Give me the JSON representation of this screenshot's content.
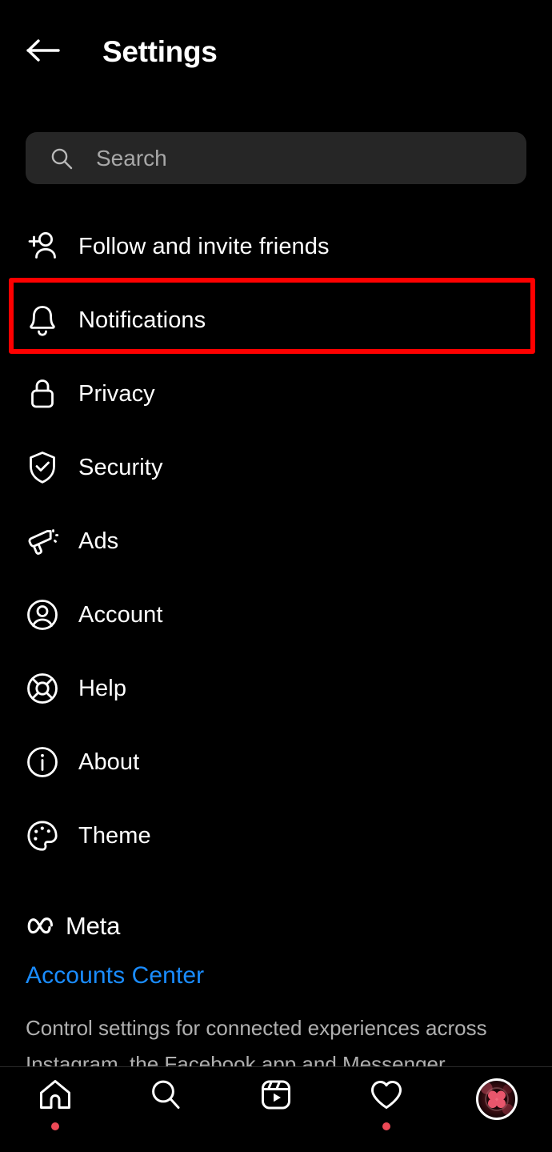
{
  "header": {
    "title": "Settings",
    "back_icon": "arrow-left-icon"
  },
  "search": {
    "placeholder": "Search",
    "value": "",
    "icon": "search-icon"
  },
  "menu": {
    "items": [
      {
        "label": "Follow and invite friends",
        "icon": "person-add-icon",
        "highlighted": false
      },
      {
        "label": "Notifications",
        "icon": "bell-icon",
        "highlighted": true
      },
      {
        "label": "Privacy",
        "icon": "lock-icon",
        "highlighted": false
      },
      {
        "label": "Security",
        "icon": "shield-check-icon",
        "highlighted": false
      },
      {
        "label": "Ads",
        "icon": "megaphone-icon",
        "highlighted": false
      },
      {
        "label": "Account",
        "icon": "person-circle-icon",
        "highlighted": false
      },
      {
        "label": "Help",
        "icon": "lifebuoy-icon",
        "highlighted": false
      },
      {
        "label": "About",
        "icon": "info-circle-icon",
        "highlighted": false
      },
      {
        "label": "Theme",
        "icon": "palette-icon",
        "highlighted": false
      }
    ]
  },
  "meta_section": {
    "brand": "Meta",
    "logo_icon": "meta-infinity-icon",
    "link_label": "Accounts Center",
    "description": "Control settings for connected experiences across Instagram, the Facebook app and Messenger."
  },
  "bottom_nav": {
    "items": [
      {
        "icon": "home-icon",
        "badge": true
      },
      {
        "icon": "search-icon",
        "badge": false
      },
      {
        "icon": "reels-icon",
        "badge": false
      },
      {
        "icon": "heart-icon",
        "badge": true
      },
      {
        "icon": "profile-avatar",
        "badge": false
      }
    ]
  },
  "colors": {
    "background": "#000000",
    "text": "#ffffff",
    "muted_text": "#b0b0b0",
    "placeholder": "#a8a8a8",
    "search_bg": "#262626",
    "link_blue": "#1a8cff",
    "highlight_red": "#fe0000",
    "badge_red": "#ed4956"
  }
}
